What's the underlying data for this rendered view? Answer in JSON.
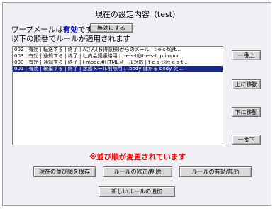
{
  "header": {
    "title": "現在の設定内容（test）"
  },
  "status": {
    "prefix": "ワープメールは",
    "state": "有効",
    "suffix": "です",
    "disable_label": "無効にする",
    "description": "以下の順番でルールが適用されます"
  },
  "rules": [
    "002 | 有効 | 転送する | 終了 | Aさん(お得意様)からのメール | t-e-s-t@t...",
    "003 | 有効 | 通知する | 終了 | 社内会議連絡用 | t-e-s-t@t-e-s-t.jp impor...",
    "000 | 有効 | 通知する | 終了 | i-mode用HTMLメール対応 | t-e-s-t@t-e-s-t...",
    "001 | 有効 | 破棄する | 終了 | 迷惑メール削除用 | (body 儲かる body 突..."
  ],
  "selected_index": 3,
  "side_buttons": {
    "top": "一番上",
    "up": "上に移動",
    "down": "下に移動",
    "bottom": "一番下"
  },
  "warning": "※並び順が変更されています",
  "bottom_buttons": {
    "save_order": "現在の並び順を保存",
    "edit_delete": "ルールの修正/削除",
    "toggle": "ルールの有効/無効",
    "add_rule": "新しいルールの追加"
  }
}
